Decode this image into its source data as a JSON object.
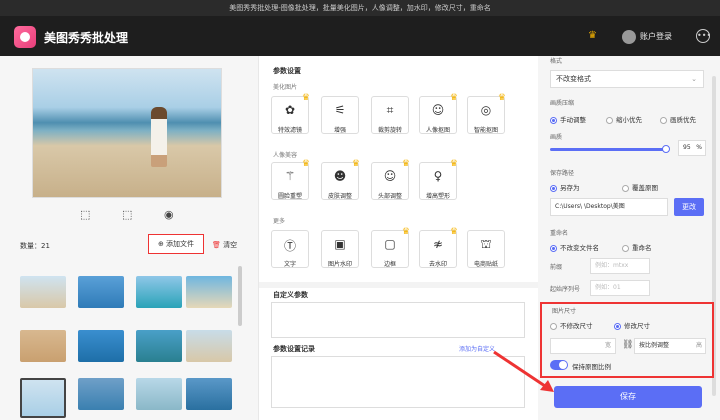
{
  "window_title": "美图秀秀批处理-图像批处理，批量美化图片，人像调整，加水印，修改尺寸，重命名",
  "app_name": "美图秀秀批处理",
  "account": "账户登录",
  "left": {
    "count": "数量：21",
    "add_file": "添加文件",
    "clear": "清空"
  },
  "mid": {
    "param_title": "参数设置",
    "cat_beauty": "美化图片",
    "beauty": [
      "特效滤镜",
      "增强",
      "裁剪旋转",
      "人像抠图",
      "智能抠图"
    ],
    "cat_face": "人像美容",
    "face": [
      "圆脸重塑",
      "皮肤调整",
      "头部调整",
      "增高塑形"
    ],
    "cat_more": "更多",
    "more": [
      "文字",
      "图片水印",
      "边框",
      "去水印",
      "电商贴纸"
    ],
    "custom_title": "自定义参数",
    "record_title": "参数设置记录",
    "add_custom": "添加为自定义"
  },
  "right": {
    "format_label": "格式",
    "format_value": "不改变格式",
    "quality_label": "画质压缩",
    "quality_opts": [
      "手动调整",
      "缩小优先",
      "画质优先"
    ],
    "quality_sub": "画质",
    "quality_value": "95",
    "quality_unit": "%",
    "save_path_label": "保存路径",
    "save_opts": [
      "另存为",
      "覆盖原图"
    ],
    "path_value": "C:\\Users\\       \\Desktop\\美图",
    "change_btn": "更改",
    "rename_label": "重命名",
    "rename_opts": [
      "不改变文件名",
      "重命名"
    ],
    "prefix_label": "前缀",
    "prefix_ph": "例如：mtxx",
    "start_label": "起始序列号",
    "start_ph": "例如：01",
    "size_label": "图片尺寸",
    "size_opts": [
      "不修改尺寸",
      "修改尺寸"
    ],
    "width_unit": "宽",
    "height_value": "按比例调整",
    "height_unit": "高",
    "keep_ratio": "保持原图比例",
    "save_btn": "保存"
  },
  "colors": {
    "accent": "#5b6ef5",
    "highlight": "#e33333",
    "crown": "#f5b300"
  }
}
